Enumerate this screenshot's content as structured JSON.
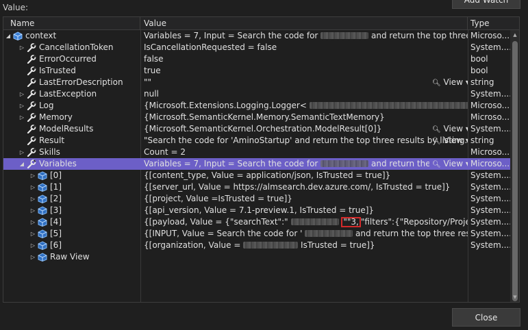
{
  "header": {
    "value_label": "Value:",
    "add_watch": "Add Watch",
    "close": "Close"
  },
  "columns": {
    "name": "Name",
    "value": "Value",
    "type": "Type"
  },
  "rows": [
    {
      "name": "context",
      "value": "Variables = 7, Input = Search the code for",
      "value_tail": "and return the top three results...",
      "type": "Microso..."
    },
    {
      "name": "CancellationToken",
      "value": "IsCancellationRequested = false",
      "type": "System...."
    },
    {
      "name": "ErrorOccurred",
      "value": "false",
      "type": "bool"
    },
    {
      "name": "IsTrusted",
      "value": "true",
      "type": "bool"
    },
    {
      "name": "LastErrorDescription",
      "value": "\"\"",
      "type": "string",
      "view": "View"
    },
    {
      "name": "LastException",
      "value": "null",
      "type": "System...."
    },
    {
      "name": "Log",
      "value": "{Microsoft.Extensions.Logging.Logger<",
      "type": "Microso..."
    },
    {
      "name": "Memory",
      "value": "{Microsoft.SemanticKernel.Memory.SemanticTextMemory}",
      "type": "Microso..."
    },
    {
      "name": "ModelResults",
      "value": "{Microsoft.SemanticKernel.Orchestration.ModelResult[0]}",
      "type": "System....",
      "view": "View"
    },
    {
      "name": "Result",
      "value": "\"Search the code for 'AminoStartup' and return the top three results by listing...",
      "type": "string",
      "view": "View"
    },
    {
      "name": "Skills",
      "value": "Count = 2",
      "type": "Microso..."
    },
    {
      "name": "Variables",
      "value": "Variables = 7, Input = Search the code for",
      "value_tail": "and return the top t...",
      "type": "Microso...",
      "view": "View"
    },
    {
      "name": "[0]",
      "value": "{[content_type, Value = application/json, IsTrusted = true]}",
      "type": "System...."
    },
    {
      "name": "[1]",
      "value": "{[server_url, Value = https://almsearch.dev.azure.com/, IsTrusted = true]}",
      "type": "System...."
    },
    {
      "name": "[2]",
      "value": "{[project, Value =",
      "value_tail": "IsTrusted = true]}",
      "type": "System...."
    },
    {
      "name": "[3]",
      "value": "{[api_version, Value = 7.1-preview.1, IsTrusted = true]}",
      "type": "System...."
    },
    {
      "name": "[4]",
      "value": "{[payload, Value = {\"searchText\":\"",
      "value_mark": "\"\"3,",
      "value_tail": "\"filters\":{\"Repository/Project\":[\"",
      "type": "System...."
    },
    {
      "name": "[5]",
      "value": "{[INPUT, Value = Search the code for '",
      "value_tail": "and return the top three results by li...",
      "type": "System...."
    },
    {
      "name": "[6]",
      "value": "{[organization, Value =",
      "value_tail": "IsTrusted = true]}",
      "type": "System...."
    },
    {
      "name": "Raw View",
      "value": "",
      "type": ""
    }
  ]
}
